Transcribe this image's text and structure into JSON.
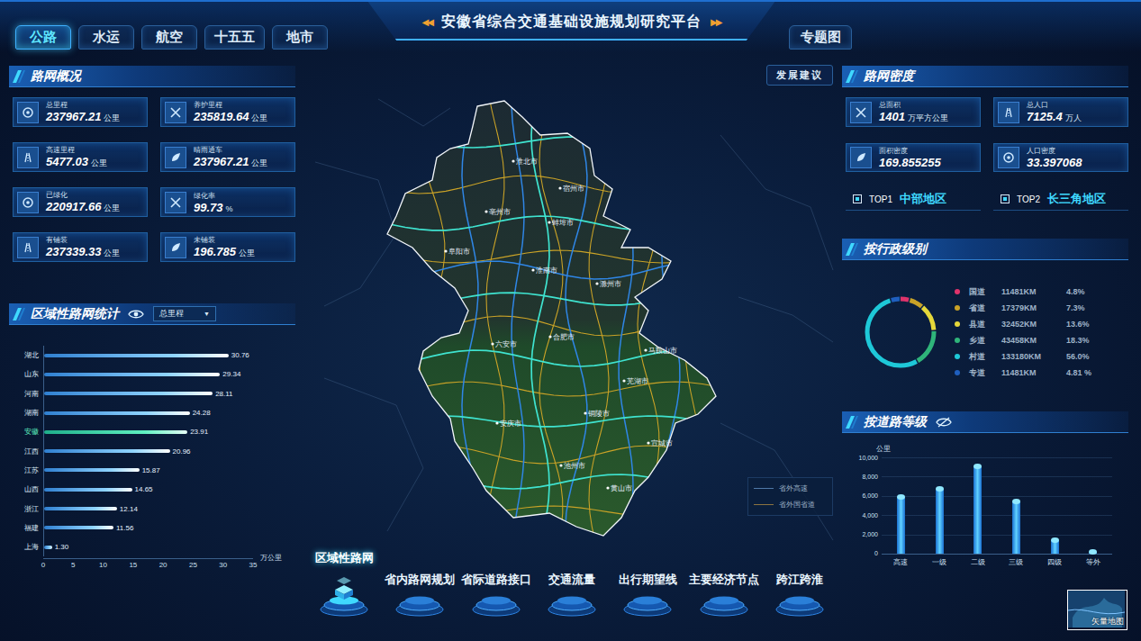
{
  "header": {
    "tabs": [
      {
        "label": "公路",
        "selected": true
      },
      {
        "label": "水运",
        "selected": false
      },
      {
        "label": "航空",
        "selected": false
      },
      {
        "label": "十五五",
        "selected": false
      },
      {
        "label": "地市",
        "selected": false
      }
    ],
    "title": "安徽省综合交通基础设施规划研究平台",
    "title_left_arrows": "◀◀",
    "title_right_arrows": "▶▶",
    "thematic_button": "专题图"
  },
  "overview": {
    "title": "路网概况",
    "stats": [
      {
        "label": "总里程",
        "value": "237967.21",
        "unit": "公里"
      },
      {
        "label": "养护里程",
        "value": "235819.64",
        "unit": "公里"
      },
      {
        "label": "高速里程",
        "value": "5477.03",
        "unit": "公里"
      },
      {
        "label": "晴雨通车",
        "value": "237967.21",
        "unit": "公里"
      },
      {
        "label": "已绿化",
        "value": "220917.66",
        "unit": "公里"
      },
      {
        "label": "绿化率",
        "value": "99.73",
        "unit": "%"
      },
      {
        "label": "有铺装",
        "value": "237339.33",
        "unit": "公里"
      },
      {
        "label": "未铺装",
        "value": "196.785",
        "unit": "公里"
      }
    ]
  },
  "regional": {
    "title": "区域性路网统计",
    "dropdown": {
      "value": "总里程",
      "arrow": "▼"
    },
    "chart": {
      "unit": "万公里",
      "max": 35,
      "ticks": [
        "0",
        "5",
        "10",
        "15",
        "20",
        "25",
        "30",
        "35"
      ],
      "bars": [
        {
          "label": "湖北",
          "value": 30.76,
          "reading": "30.76",
          "selected": false
        },
        {
          "label": "山东",
          "value": 29.34,
          "reading": "29.34",
          "selected": false
        },
        {
          "label": "河南",
          "value": 28.11,
          "reading": "28.11",
          "selected": false
        },
        {
          "label": "湖南",
          "value": 24.28,
          "reading": "24.28",
          "selected": false
        },
        {
          "label": "安徽",
          "value": 23.91,
          "reading": "23.91",
          "selected": true
        },
        {
          "label": "江西",
          "value": 20.96,
          "reading": "20.96",
          "selected": false
        },
        {
          "label": "江苏",
          "value": 15.87,
          "reading": "15.87",
          "selected": false
        },
        {
          "label": "山西",
          "value": 14.65,
          "reading": "14.65",
          "selected": false
        },
        {
          "label": "浙江",
          "value": 12.14,
          "reading": "12.14",
          "selected": false
        },
        {
          "label": "福建",
          "value": 11.56,
          "reading": "11.56",
          "selected": false
        },
        {
          "label": "上海",
          "value": 1.3,
          "reading": "1.30",
          "selected": false
        }
      ]
    }
  },
  "advice_button": "发展建议",
  "map": {
    "cities": [
      "淮北市",
      "宿州市",
      "亳州市",
      "蚌埠市",
      "阜阳市",
      "淮南市",
      "滁州市",
      "六安市",
      "合肥市",
      "马鞍山市",
      "芜湖市",
      "铜陵市",
      "安庆市",
      "宣城市",
      "池州市",
      "黄山市"
    ],
    "legend": [
      {
        "label": "省外高速",
        "color": "#4f79a8"
      },
      {
        "label": "省外国省道",
        "color": "#8c7340"
      }
    ],
    "basemap_button": "矢量地图"
  },
  "density": {
    "title": "路网密度",
    "stats": [
      {
        "label": "总面积",
        "value": "1401",
        "unit": "万平方公里"
      },
      {
        "label": "总人口",
        "value": "7125.4",
        "unit": "万人"
      },
      {
        "label": "面积密度",
        "value": "169.855255"
      },
      {
        "label": "人口密度",
        "value": "33.397068"
      }
    ],
    "top": [
      {
        "rank": "TOP1",
        "region": "中部地区"
      },
      {
        "rank": "TOP2",
        "region": "长三角地区"
      }
    ]
  },
  "admin_level": {
    "title": "按行政级别",
    "items": [
      {
        "label": "国道",
        "length": "11481KM",
        "percent": "4.8%",
        "value": 4.8,
        "color": "#e0336b"
      },
      {
        "label": "省道",
        "length": "17379KM",
        "percent": "7.3%",
        "value": 7.3,
        "color": "#c9a227"
      },
      {
        "label": "县道",
        "length": "32452KM",
        "percent": "13.6%",
        "value": 13.6,
        "color": "#e6d83a"
      },
      {
        "label": "乡道",
        "length": "43458KM",
        "percent": "18.3%",
        "value": 18.3,
        "color": "#2fb57a"
      },
      {
        "label": "村道",
        "length": "133180KM",
        "percent": "56.0%",
        "value": 56.0,
        "color": "#1ec8d8"
      },
      {
        "label": "专道",
        "length": "11481KM",
        "percent": "4.81 %",
        "value": 4.81,
        "color": "#1f5fbf"
      }
    ]
  },
  "road_grade": {
    "title": "按道路等级",
    "unit": "公里",
    "max": 10000,
    "ticks": [
      "0",
      "2,000",
      "4,000",
      "6,000",
      "8,000",
      "10,000"
    ],
    "categories": [
      "高速",
      "一级",
      "二级",
      "三级",
      "四级",
      "等外"
    ],
    "values": [
      5900,
      6750,
      9050,
      5400,
      1400,
      150
    ]
  },
  "bottom_nav": [
    {
      "label": "区域性路网",
      "selected": true
    },
    {
      "label": "省内路网规划",
      "selected": false
    },
    {
      "label": "省际道路接口",
      "selected": false
    },
    {
      "label": "交通流量",
      "selected": false
    },
    {
      "label": "出行期望线",
      "selected": false
    },
    {
      "label": "主要经济节点",
      "selected": false
    },
    {
      "label": "跨江跨淮",
      "selected": false
    }
  ]
}
